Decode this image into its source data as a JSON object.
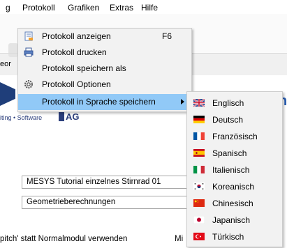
{
  "menubar": {
    "items": [
      {
        "label": "g"
      },
      {
        "label": "Protokoll"
      },
      {
        "label": "Grafiken"
      },
      {
        "label": "Extras"
      },
      {
        "label": "Hilfe"
      }
    ]
  },
  "background": {
    "tab_fragment": "eor",
    "company_line": "iting • Software",
    "company_ag": "AG",
    "partial_letter": "h",
    "field1_value": "MESYS Tutorial einzelnes Stirnrad 01",
    "field2_value": "Geometrieberechnungen",
    "bottom_text": "pitch' statt Normalmodul verwenden",
    "bottom_text_right": "Mi"
  },
  "protokoll_menu": {
    "items": [
      {
        "label": "Protokoll anzeigen",
        "shortcut": "F6",
        "icon": "document-view-icon"
      },
      {
        "label": "Protokoll drucken",
        "shortcut": "",
        "icon": "printer-icon"
      },
      {
        "label": "Protokoll speichern als",
        "shortcut": "",
        "icon": ""
      },
      {
        "label": "Protokoll Optionen",
        "shortcut": "",
        "icon": "gear-icon"
      },
      {
        "label": "Protokoll in Sprache speichern",
        "shortcut": "",
        "icon": "",
        "has_submenu": true
      }
    ],
    "highlight_color": "#91c9f7"
  },
  "language_menu": {
    "items": [
      {
        "label": "Englisch",
        "flag": "uk-flag-icon"
      },
      {
        "label": "Deutsch",
        "flag": "germany-flag-icon"
      },
      {
        "label": "Französisch",
        "flag": "france-flag-icon"
      },
      {
        "label": "Spanisch",
        "flag": "spain-flag-icon"
      },
      {
        "label": "Italienisch",
        "flag": "italy-flag-icon"
      },
      {
        "label": "Koreanisch",
        "flag": "korea-flag-icon"
      },
      {
        "label": "Chinesisch",
        "flag": "china-flag-icon"
      },
      {
        "label": "Japanisch",
        "flag": "japan-flag-icon"
      },
      {
        "label": "Türkisch",
        "flag": "turkey-flag-icon"
      }
    ]
  }
}
